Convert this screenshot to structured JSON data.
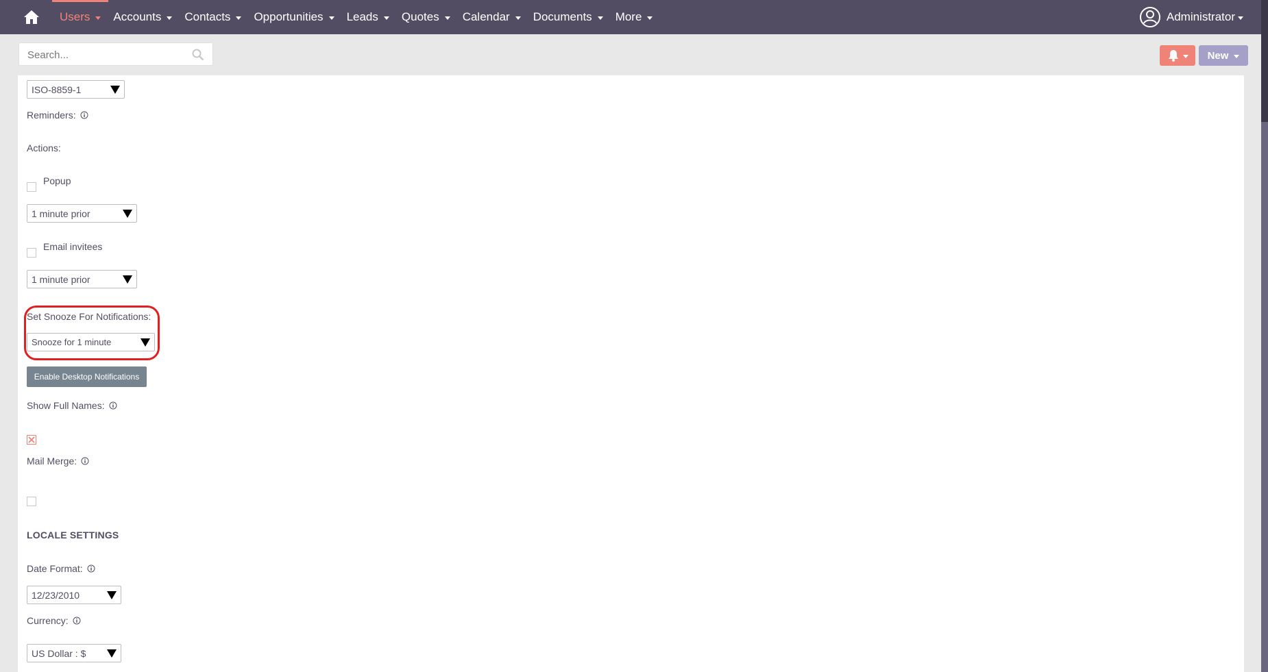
{
  "nav": {
    "items": [
      {
        "label": "Users",
        "active": true
      },
      {
        "label": "Accounts"
      },
      {
        "label": "Contacts"
      },
      {
        "label": "Opportunities"
      },
      {
        "label": "Leads"
      },
      {
        "label": "Quotes"
      },
      {
        "label": "Calendar"
      },
      {
        "label": "Documents"
      },
      {
        "label": "More"
      }
    ],
    "user_label": "Administrator"
  },
  "search": {
    "placeholder": "Search..."
  },
  "toolbar": {
    "new_label": "New"
  },
  "form": {
    "charset_value": "ISO-8859-1",
    "reminders_label": "Reminders:",
    "actions_label": "Actions:",
    "popup_label": "Popup",
    "popup_time": "1 minute prior",
    "email_label": "Email invitees",
    "email_time": "1 minute prior",
    "snooze_label": "Set Snooze For Notifications:",
    "snooze_value": "Snooze for 1 minute",
    "desktop_btn": "Enable Desktop Notifications",
    "full_names_label": "Show Full Names:",
    "mail_merge_label": "Mail Merge:",
    "locale_title": "LOCALE SETTINGS",
    "date_format_label": "Date Format:",
    "date_format_value": "12/23/2010",
    "currency_label": "Currency:",
    "currency_value": "US Dollar : $"
  },
  "colors": {
    "navbar": "#534d64",
    "accent": "#f08377",
    "new_button": "#a5a0c8",
    "highlight": "#e02020"
  }
}
